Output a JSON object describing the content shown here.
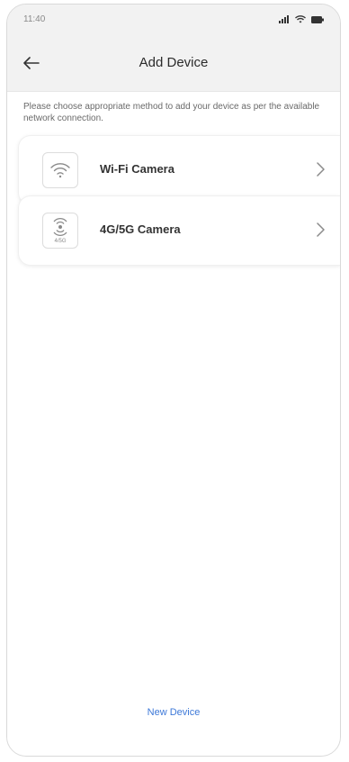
{
  "status_bar": {
    "time": "11:40",
    "icons": [
      "cellular-signal-icon",
      "wifi-icon",
      "battery-icon"
    ]
  },
  "header": {
    "back_icon": "arrow-left-icon",
    "title": "Add Device"
  },
  "main": {
    "description": "Please choose appropriate method to add your device as per the available network connection.",
    "options": [
      {
        "label": "Wi-Fi Camera",
        "icon": "wifi-icon"
      },
      {
        "label": "4G/5G Camera",
        "icon": "cellular-antenna-icon",
        "icon_caption": "4/5G"
      }
    ]
  },
  "footer": {
    "link_label": "New Device"
  },
  "colors": {
    "accent": "#3d78d8",
    "background": "#f6f6f6",
    "text_primary": "#333333",
    "text_secondary": "#6a6a6a"
  }
}
